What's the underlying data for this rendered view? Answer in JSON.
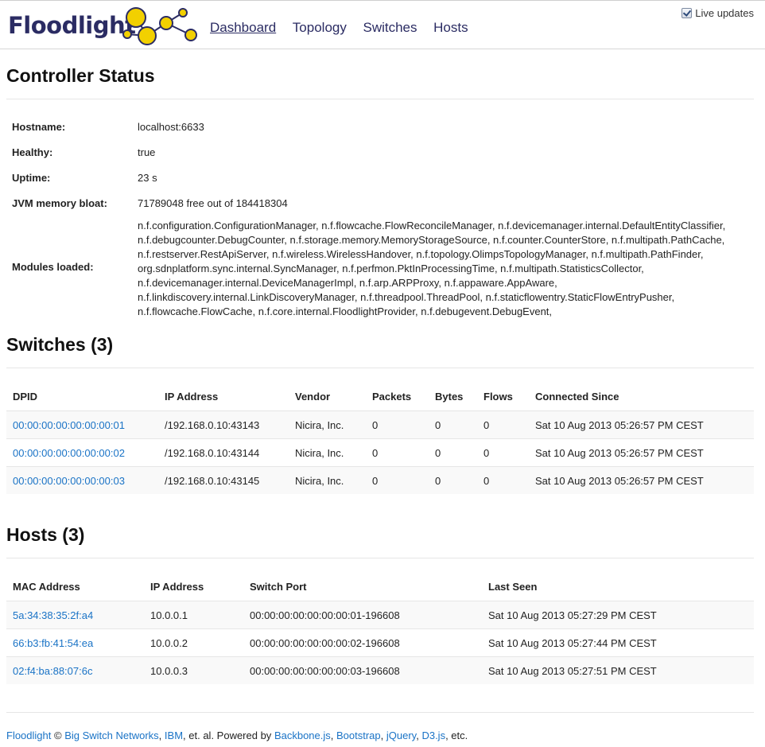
{
  "header": {
    "logo_text": "Floodlight",
    "nav": [
      {
        "label": "Dashboard",
        "active": true
      },
      {
        "label": "Topology"
      },
      {
        "label": "Switches"
      },
      {
        "label": "Hosts"
      }
    ],
    "live_updates": {
      "label": "Live updates",
      "checked": true
    },
    "logo_icon": "molecule-bubbles-icon",
    "colors": {
      "brand": "#2b2c63",
      "bubble": "#f2d000",
      "link": "#1a73c6"
    }
  },
  "controller": {
    "title": "Controller Status",
    "rows": [
      {
        "label": "Hostname:",
        "value": "localhost:6633"
      },
      {
        "label": "Healthy:",
        "value": "true"
      },
      {
        "label": "Uptime:",
        "value": "23 s"
      },
      {
        "label": "JVM memory bloat:",
        "value": "71789048 free out of 184418304"
      }
    ],
    "modules_label": "Modules loaded:",
    "modules_lines": [
      "n.f.configuration.ConfigurationManager, n.f.flowcache.FlowReconcileManager, n.f.devicemanager.internal.DefaultEntityClassifier,",
      "n.f.debugcounter.DebugCounter, n.f.storage.memory.MemoryStorageSource, n.f.counter.CounterStore, n.f.multipath.PathCache,",
      "n.f.restserver.RestApiServer, n.f.wireless.WirelessHandover, n.f.topology.OlimpsTopologyManager, n.f.multipath.PathFinder,",
      "org.sdnplatform.sync.internal.SyncManager, n.f.perfmon.PktInProcessingTime, n.f.multipath.StatisticsCollector,",
      "n.f.devicemanager.internal.DeviceManagerImpl, n.f.arp.ARPProxy, n.f.appaware.AppAware,",
      "n.f.linkdiscovery.internal.LinkDiscoveryManager, n.f.threadpool.ThreadPool, n.f.staticflowentry.StaticFlowEntryPusher,",
      "n.f.flowcache.FlowCache, n.f.core.internal.FloodlightProvider, n.f.debugevent.DebugEvent,"
    ]
  },
  "switches": {
    "title": "Switches (3)",
    "columns": [
      "DPID",
      "IP Address",
      "Vendor",
      "Packets",
      "Bytes",
      "Flows",
      "Connected Since"
    ],
    "rows": [
      [
        "00:00:00:00:00:00:00:01",
        "/192.168.0.10:43143",
        "Nicira, Inc.",
        "0",
        "0",
        "0",
        "Sat 10 Aug 2013 05:26:57 PM CEST"
      ],
      [
        "00:00:00:00:00:00:00:02",
        "/192.168.0.10:43144",
        "Nicira, Inc.",
        "0",
        "0",
        "0",
        "Sat 10 Aug 2013 05:26:57 PM CEST"
      ],
      [
        "00:00:00:00:00:00:00:03",
        "/192.168.0.10:43145",
        "Nicira, Inc.",
        "0",
        "0",
        "0",
        "Sat 10 Aug 2013 05:26:57 PM CEST"
      ]
    ]
  },
  "hosts": {
    "title": "Hosts (3)",
    "columns": [
      "MAC Address",
      "IP Address",
      "Switch Port",
      "Last Seen"
    ],
    "rows": [
      [
        "5a:34:38:35:2f:a4",
        "10.0.0.1",
        "00:00:00:00:00:00:00:01-196608",
        "Sat 10 Aug 2013 05:27:29 PM CEST"
      ],
      [
        "66:b3:fb:41:54:ea",
        "10.0.0.2",
        "00:00:00:00:00:00:00:02-196608",
        "Sat 10 Aug 2013 05:27:44 PM CEST"
      ],
      [
        "02:f4:ba:88:07:6c",
        "10.0.0.3",
        "00:00:00:00:00:00:00:03-196608",
        "Sat 10 Aug 2013 05:27:51 PM CEST"
      ]
    ]
  },
  "footer": {
    "floodlight": "Floodlight",
    "copyright": " © ",
    "bsn": "Big Switch Networks",
    "sep1": ", ",
    "ibm": "IBM",
    "etal": ", et. al. Powered by ",
    "backbone": "Backbone.js",
    "sep2": ", ",
    "bootstrap": "Bootstrap",
    "sep3": ", ",
    "jquery": "jQuery",
    "sep4": ", ",
    "d3": "D3.js",
    "etc": ", etc."
  }
}
